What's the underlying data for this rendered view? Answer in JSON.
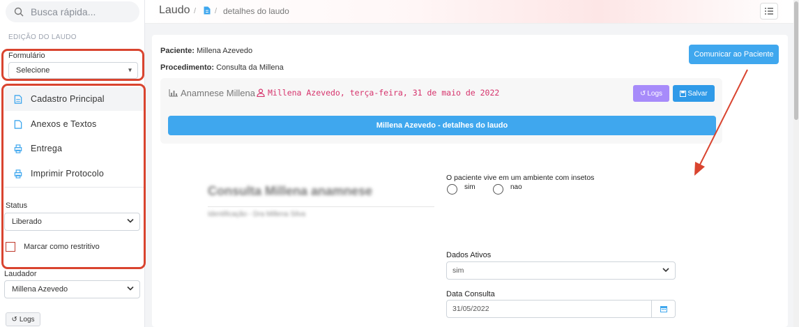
{
  "sidebar": {
    "search_placeholder": "Busca rápida...",
    "section_title": "EDIÇÃO DO LAUDO",
    "formulario_label": "Formulário",
    "formulario_value": "Selecione",
    "menu": [
      {
        "label": "Cadastro Principal"
      },
      {
        "label": "Anexos e Textos"
      },
      {
        "label": "Entrega"
      },
      {
        "label": "Imprimir Protocolo"
      }
    ],
    "status_label": "Status",
    "status_value": "Liberado",
    "restrict_label": "Marcar como restritivo",
    "laudador_label": "Laudador",
    "laudador_value": "Millena Azevedo",
    "logs_label": "Logs"
  },
  "breadcrumb": {
    "title": "Laudo",
    "separator": "/",
    "last": "detalhes do laudo"
  },
  "header": {
    "patient_key": "Paciente:",
    "patient_value": "Millena Azevedo",
    "procedure_key": "Procedimento:",
    "procedure_value": "Consulta da Millena",
    "communicate_button": "Comunicar ao Paciente"
  },
  "panel": {
    "title": "Anamnese Millena",
    "subtitle": "Millena Azevedo, terça-feira, 31 de maio de 2022",
    "logs_button": "Logs",
    "save_button": "Salvar",
    "bar_label": "Millena Azevedo - detalhes do laudo"
  },
  "blurred": {
    "heading": "Consulta Millena anamnese",
    "sub": "Identificação - Dra Millena Silva"
  },
  "form": {
    "question": "O paciente vive em um ambiente com insetos",
    "options": [
      "sim",
      "nao"
    ],
    "dados_label": "Dados Ativos",
    "dados_value": "sim",
    "data_label": "Data Consulta",
    "data_value": "31/05/2022"
  },
  "colors": {
    "highlight": "#d9442f",
    "primary": "#3fa7ee",
    "purple": "#a78bfa",
    "pink_text": "#d6336c"
  }
}
